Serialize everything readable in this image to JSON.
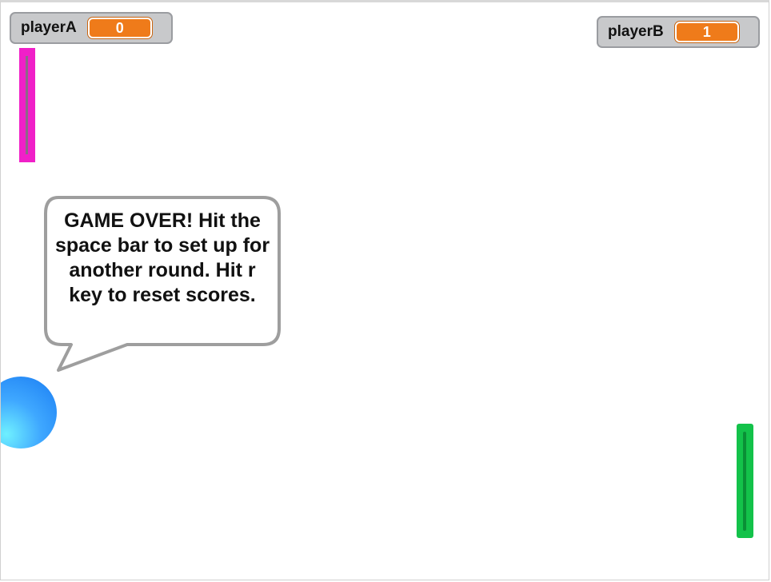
{
  "monitors": {
    "playerA": {
      "label": "playerA",
      "value": "0"
    },
    "playerB": {
      "label": "playerB",
      "value": "1"
    }
  },
  "speech_bubble": {
    "text": "GAME OVER! Hit the space bar to set up for another round. Hit r key to reset scores."
  },
  "colors": {
    "monitor_value_bg": "#ef7b1a",
    "paddle_a": "#f020c8",
    "paddle_b": "#13c24a",
    "ball": "#3fa8ff"
  }
}
